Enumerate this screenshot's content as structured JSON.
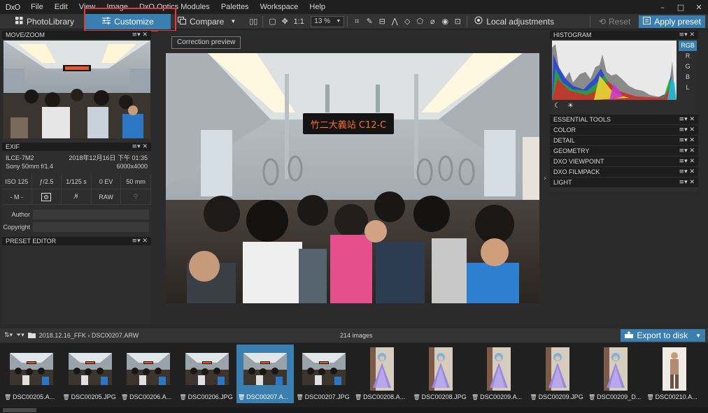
{
  "menubar": {
    "logo": "DxO",
    "items": [
      "File",
      "Edit",
      "View",
      "Image",
      "DxO Optics Modules",
      "Palettes",
      "Workspace",
      "Help"
    ],
    "window_controls": [
      "–",
      "□",
      "✕"
    ]
  },
  "toolbar": {
    "photolibrary": "PhotoLibrary",
    "customize": "Customize",
    "compare": "Compare",
    "one_to_one": "1:1",
    "zoom": "13 %",
    "local_adjustments": "Local adjustments",
    "reset": "Reset",
    "apply_preset": "Apply preset"
  },
  "tooltip": "Correction preview",
  "left_panel": {
    "movezoom_title": "MOVE/ZOOM",
    "exif_title": "EXIF",
    "camera": "ILCE-7M2",
    "datetime": "2018年12月16日 下午 01:35",
    "lens": "Sony 50mm f/1.4",
    "dimensions": "6000x4000",
    "exif_values": [
      "ISO 125",
      "ƒ/2.5",
      "1/125 s",
      "0 EV",
      "50 mm"
    ],
    "exif_modes": [
      "- M -",
      "",
      "",
      "RAW",
      ""
    ],
    "author_label": "Author",
    "copyright_label": "Copyright",
    "preset_editor_title": "PRESET EDITOR"
  },
  "viewer": {
    "sign_text": "竹二大義站 C12-C"
  },
  "right_panel": {
    "histogram_title": "HISTOGRAM",
    "channels": [
      "RGB",
      "R",
      "G",
      "B",
      "L"
    ],
    "tools": [
      "ESSENTIAL TOOLS",
      "COLOR",
      "DETAIL",
      "GEOMETRY",
      "DXO VIEWPOINT",
      "DXO FILMPACK",
      "LIGHT"
    ]
  },
  "filmbar": {
    "path": "2018.12.16_FFK › DSC00207.ARW",
    "count": "214 images",
    "export": "Export to disk"
  },
  "filmstrip": [
    {
      "name": "DSC00205.A...",
      "kind": "train",
      "selected": false
    },
    {
      "name": "DSC00205.JPG",
      "kind": "train",
      "selected": false
    },
    {
      "name": "DSC00206.A...",
      "kind": "train",
      "selected": false
    },
    {
      "name": "DSC00206.JPG",
      "kind": "train",
      "selected": false
    },
    {
      "name": "DSC00207.A...",
      "kind": "train",
      "selected": true
    },
    {
      "name": "DSC00207.JPG",
      "kind": "train",
      "selected": false
    },
    {
      "name": "DSC00208.A...",
      "kind": "cos",
      "selected": false
    },
    {
      "name": "DSC00208.JPG",
      "kind": "cos",
      "selected": false
    },
    {
      "name": "DSC00209.A...",
      "kind": "cos",
      "selected": false
    },
    {
      "name": "DSC00209.JPG",
      "kind": "cos",
      "selected": false
    },
    {
      "name": "DSC00209_D...",
      "kind": "cos",
      "selected": false
    },
    {
      "name": "DSC00210.A...",
      "kind": "cos2",
      "selected": false
    }
  ],
  "colors": {
    "accent": "#3b7fb0",
    "highlight": "#e03b3b"
  }
}
